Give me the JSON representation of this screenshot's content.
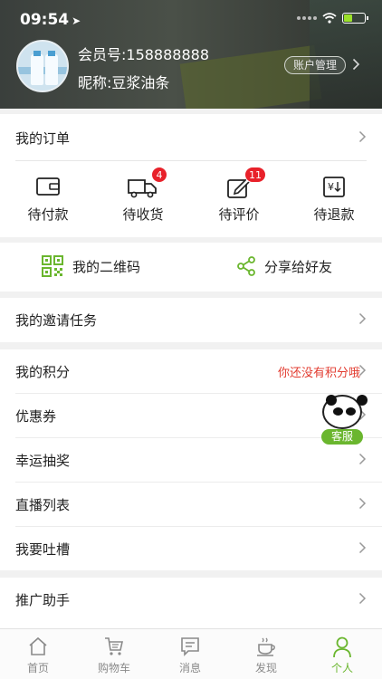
{
  "status_bar": {
    "time": "09:54",
    "location_glyph": "➤"
  },
  "profile": {
    "member_no": "会员号:158888888",
    "nickname": "昵称:豆浆油条",
    "account_button": "账户管理"
  },
  "orders": {
    "title": "我的订单",
    "tabs": [
      {
        "label": "待付款",
        "icon": "wallet-icon",
        "badge": ""
      },
      {
        "label": "待收货",
        "icon": "truck-icon",
        "badge": "4"
      },
      {
        "label": "待评价",
        "icon": "edit-review-icon",
        "badge": "11"
      },
      {
        "label": "待退款",
        "icon": "refund-icon",
        "badge": ""
      }
    ]
  },
  "quick": {
    "qr_label": "我的二维码",
    "share_label": "分享给好友"
  },
  "invite": {
    "label": "我的邀请任务"
  },
  "points": {
    "label": "我的积分",
    "hint": "你还没有积分哦"
  },
  "menu": [
    {
      "label": "优惠券"
    },
    {
      "label": "幸运抽奖"
    },
    {
      "label": "直播列表"
    },
    {
      "label": "我要吐槽"
    }
  ],
  "promo": {
    "label": "推广助手"
  },
  "customer_service": {
    "label": "客服"
  },
  "tabbar": {
    "items": [
      {
        "label": "首页",
        "icon": "home-icon"
      },
      {
        "label": "购物车",
        "icon": "cart-icon"
      },
      {
        "label": "消息",
        "icon": "message-icon"
      },
      {
        "label": "发现",
        "icon": "coffee-icon"
      },
      {
        "label": "个人",
        "icon": "person-icon"
      }
    ],
    "active_color": "#6ab62e"
  },
  "colors": {
    "accent_green": "#6ab62e",
    "badge_red": "#e8212a",
    "hint_red": "#e23b2f"
  }
}
